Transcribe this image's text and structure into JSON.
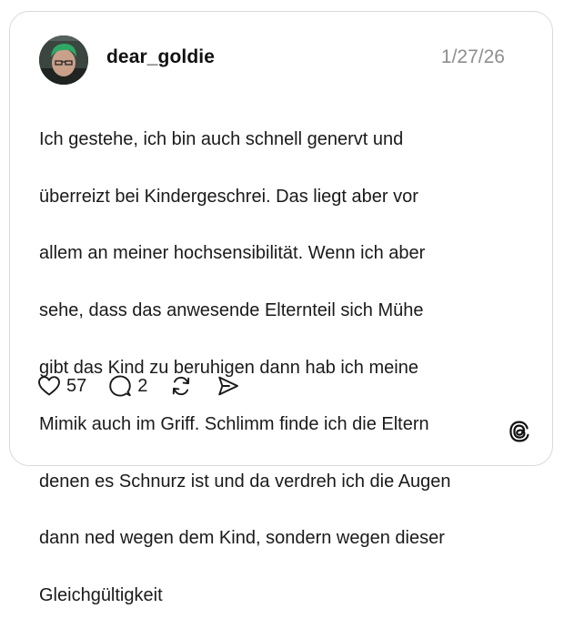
{
  "post": {
    "username": "dear_goldie",
    "date": "1/27/26",
    "text_lines": [
      "Ich gestehe, ich bin auch schnell genervt und",
      "überreizt bei Kindergeschrei. Das liegt aber vor",
      "allem an meiner hochsensibilität. Wenn ich aber",
      "sehe, dass das anwesende Elternteil sich Mühe",
      "gibt das Kind zu beruhigen dann hab ich meine",
      "Mimik auch im Griff. Schlimm finde ich die Eltern",
      "denen es Schnurz ist und da verdreh ich die Augen",
      "dann ned wegen dem Kind, sondern wegen dieser",
      "Gleichgültigkeit"
    ]
  },
  "actions": {
    "likes": "57",
    "replies": "2",
    "icons": [
      "heart-icon",
      "comment-icon",
      "repost-icon",
      "share-icon"
    ]
  },
  "branding": {
    "logo": "threads-logo"
  },
  "colors": {
    "text": "#1a1a1a",
    "muted": "#8e8e8e",
    "border": "#d9d9d9"
  }
}
